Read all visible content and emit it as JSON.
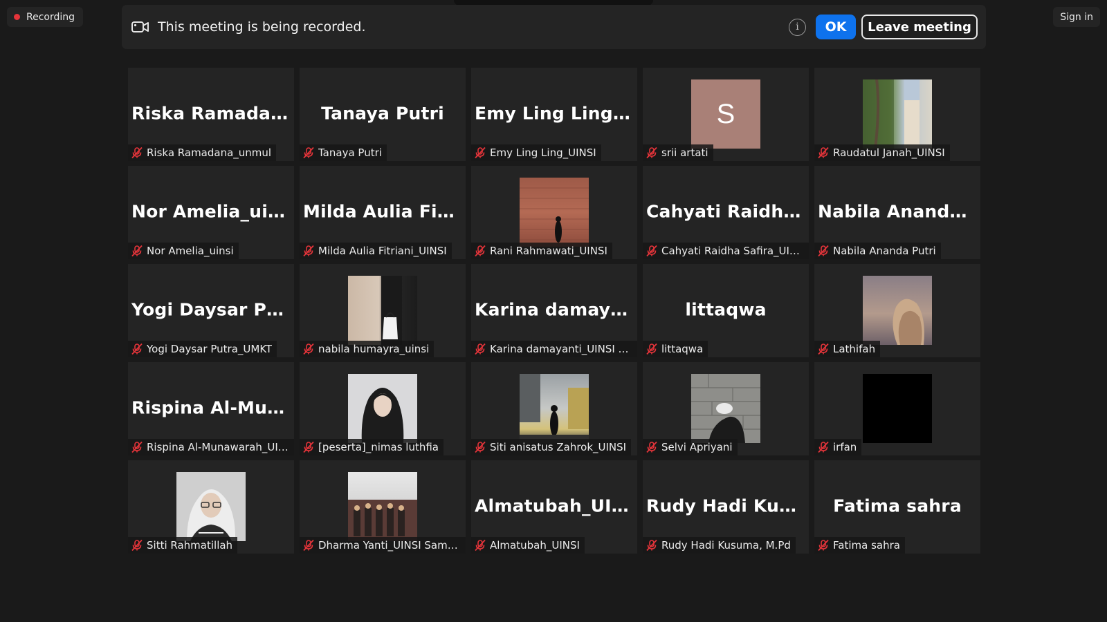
{
  "recording": {
    "label": "Recording"
  },
  "sign_in": {
    "label": "Sign in"
  },
  "banner": {
    "message": "This meeting is being recorded.",
    "info_icon": "info-icon",
    "ok_label": "OK",
    "leave_label": "Leave meeting"
  },
  "colors": {
    "background": "#1a1a1a",
    "tile": "#242424",
    "accent": "#0e72ed",
    "muted_mic": "#e5343a"
  },
  "participants": [
    {
      "display": "Riska  Ramadan...",
      "name": "Riska Ramadana_unmul"
    },
    {
      "display": "Tanaya Putri",
      "name": "Tanaya Putri"
    },
    {
      "display": "Emy Ling Ling_...",
      "name": "Emy Ling Ling_UINSI"
    },
    {
      "avatar_letter": "S",
      "name": "srii artati"
    },
    {
      "name": "Raudatul Janah_UINSI"
    },
    {
      "display": "Nor Amelia_uinsi",
      "name": "Nor Amelia_uinsi"
    },
    {
      "display": "Milda Aulia Fitri...",
      "name": "Milda Aulia Fitriani_UINSI"
    },
    {
      "name": "Rani Rahmawati_UINSI"
    },
    {
      "display": "Cahyati  Raidha...",
      "name": "Cahyati Raidha Safira_UINSI"
    },
    {
      "display": "Nabila  Ananda...",
      "name": "Nabila Ananda Putri"
    },
    {
      "display": "Yogi  Daysar  Put...",
      "name": "Yogi Daysar Putra_UMKT"
    },
    {
      "name": "nabila humayra_uinsi"
    },
    {
      "display": "Karina  damaya...",
      "name": "Karina damayanti_UINSI Sa..."
    },
    {
      "display": "littaqwa",
      "name": "littaqwa"
    },
    {
      "name": "Lathifah"
    },
    {
      "display": "Rispina  Al-Mun...",
      "name": "Rispina Al-Munawarah_UINSI"
    },
    {
      "name": "[peserta]_nimas luthfia"
    },
    {
      "name": "Siti anisatus Zahrok_UINSI"
    },
    {
      "name": "Selvi Apriyani"
    },
    {
      "name": "irfan"
    },
    {
      "name": "Sitti Rahmatillah"
    },
    {
      "name": "Dharma Yanti_UINSI Samari..."
    },
    {
      "display": "Almatubah_UINSI",
      "name": "Almatubah_UINSI"
    },
    {
      "display": "Rudy  Hadi  Kusu...",
      "name": "Rudy Hadi Kusuma, M.Pd"
    },
    {
      "display": "Fatima sahra",
      "name": "Fatima sahra"
    }
  ]
}
